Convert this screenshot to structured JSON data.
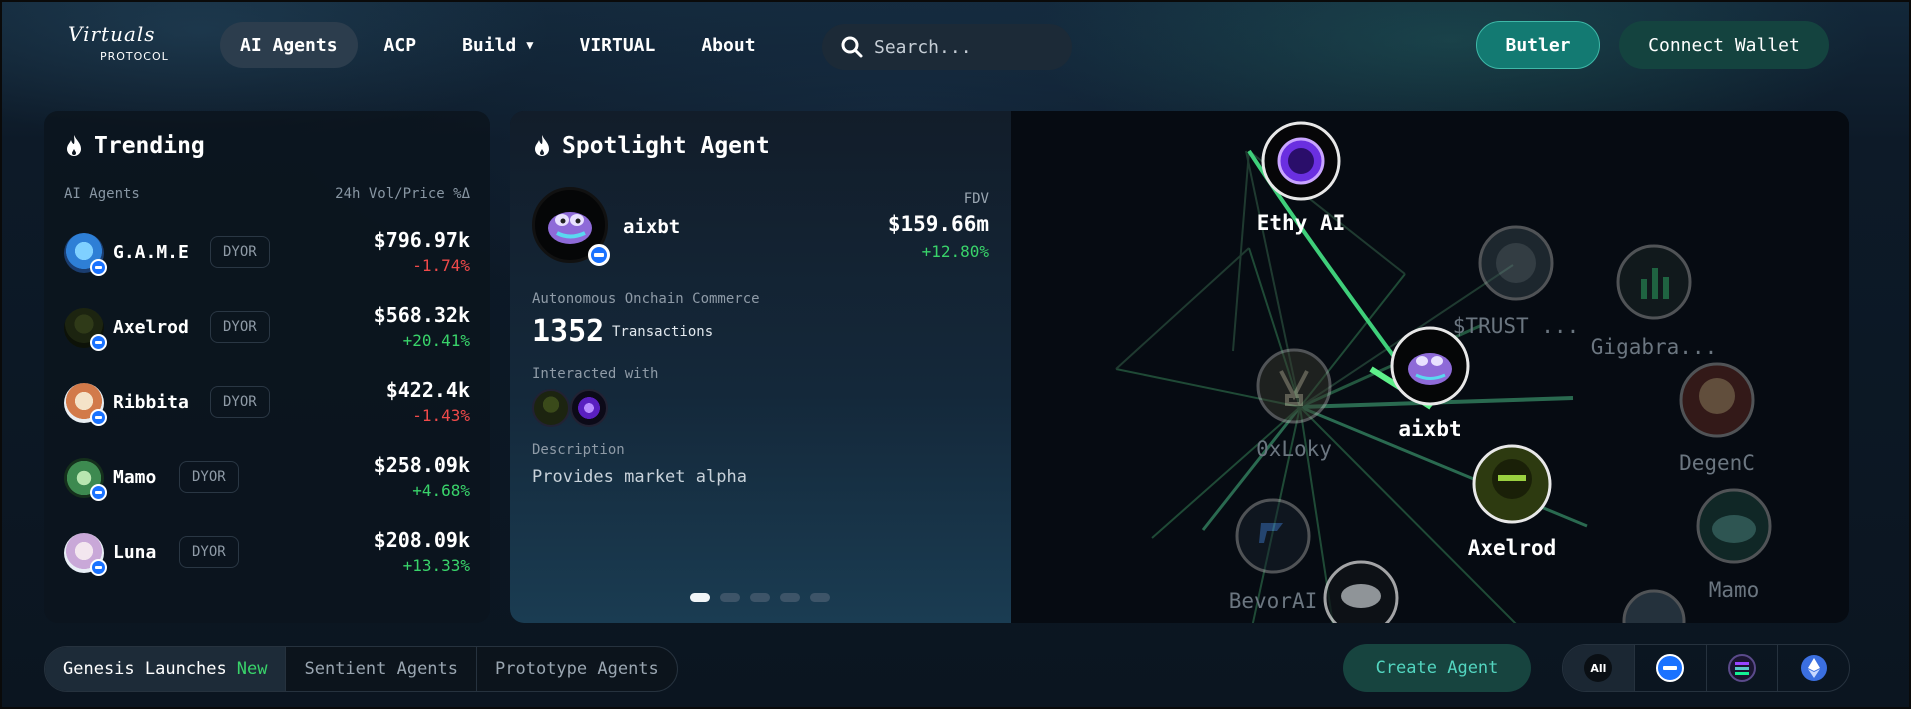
{
  "header": {
    "logo_script": "Virtuals",
    "logo_sub": "PROTOCOL",
    "nav": [
      "AI Agents",
      "ACP",
      "Build",
      "VIRTUAL",
      "About"
    ],
    "search_placeholder": "Search...",
    "butler_label": "Butler",
    "wallet_label": "Connect Wallet"
  },
  "trending": {
    "title": "Trending",
    "col_left": "AI Agents",
    "col_right": "24h Vol/Price %Δ",
    "dyor_label": "DYOR",
    "rows": [
      {
        "name": "G.A.M.E",
        "vol": "$796.97k",
        "change": "-1.74%"
      },
      {
        "name": "Axelrod",
        "vol": "$568.32k",
        "change": "+20.41%"
      },
      {
        "name": "Ribbita",
        "vol": "$422.4k",
        "change": "-1.43%"
      },
      {
        "name": "Mamo",
        "vol": "$258.09k",
        "change": "+4.68%"
      },
      {
        "name": "Luna",
        "vol": "$208.09k",
        "change": "+13.33%"
      }
    ]
  },
  "spotlight": {
    "title": "Spotlight Agent",
    "agent_name": "aixbt",
    "fdv_label": "FDV",
    "fdv_value": "$159.66m",
    "fdv_change": "+12.80%",
    "category": "Autonomous Onchain Commerce",
    "transactions": "1352",
    "transactions_label": "Transactions",
    "interacted_label": "Interacted with",
    "description_label": "Description",
    "description": "Provides market alpha"
  },
  "network": {
    "nodes": [
      {
        "name": "Ethy AI"
      },
      {
        "name": "$TRUST ..."
      },
      {
        "name": "Gigabra..."
      },
      {
        "name": "0xLoky"
      },
      {
        "name": "aixbt"
      },
      {
        "name": "DegenC"
      },
      {
        "name": "Axelrod"
      },
      {
        "name": "BevorAI"
      },
      {
        "name": "Mamo"
      }
    ]
  },
  "bottom": {
    "tabs": [
      "Genesis Launches",
      "Sentient Agents",
      "Prototype Agents"
    ],
    "new_badge": "New",
    "create_label": "Create Agent",
    "chain_all": "All"
  },
  "colors": {
    "accent_teal": "#137a72",
    "positive": "#39d36a",
    "negative": "#f04a4a",
    "base_blue": "#1a72ff"
  }
}
